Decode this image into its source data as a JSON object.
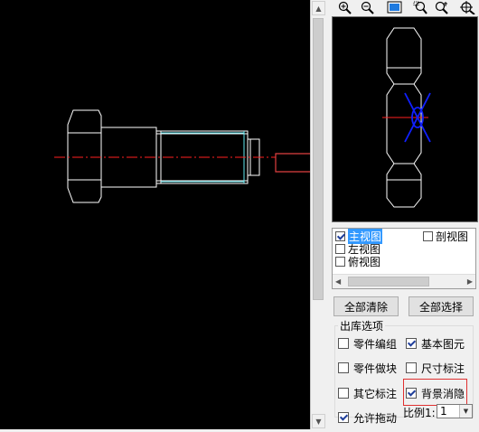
{
  "toolbar": {
    "buttons": [
      "zoom-in-icon",
      "zoom-out-icon",
      "fit-window-icon",
      "zoom-window-icon",
      "zoom-dynamic-icon",
      "pan-icon"
    ]
  },
  "views": {
    "items": [
      {
        "label": "主视图",
        "checked": true,
        "selected": true
      },
      {
        "label": "剖视图",
        "checked": false,
        "selected": false
      },
      {
        "label": "左视图",
        "checked": false,
        "selected": false
      },
      {
        "label": "俯视图",
        "checked": false,
        "selected": false
      }
    ]
  },
  "buttons": {
    "clear_all": "全部清除",
    "select_all": "全部选择"
  },
  "options": {
    "title": "出库选项",
    "items": [
      {
        "label": "零件编组",
        "checked": false
      },
      {
        "label": "基本图元",
        "checked": true
      },
      {
        "label": "零件做块",
        "checked": false
      },
      {
        "label": "尺寸标注",
        "checked": false
      },
      {
        "label": "其它标注",
        "checked": false
      },
      {
        "label": "背景消隐",
        "checked": true
      }
    ]
  },
  "bottom": {
    "allow_drag_label": "允许拖动",
    "allow_drag_checked": true,
    "scale_label": "比例1:",
    "scale_value": "1"
  },
  "colors": {
    "canvas": "#000000",
    "drawing_lines": "#ffffff",
    "centerline": "#ff2020",
    "thread_lines": "#5fe8f0",
    "preview_marker": "#1020ff",
    "arrow": "#e04040",
    "highlight": "#e03030"
  }
}
